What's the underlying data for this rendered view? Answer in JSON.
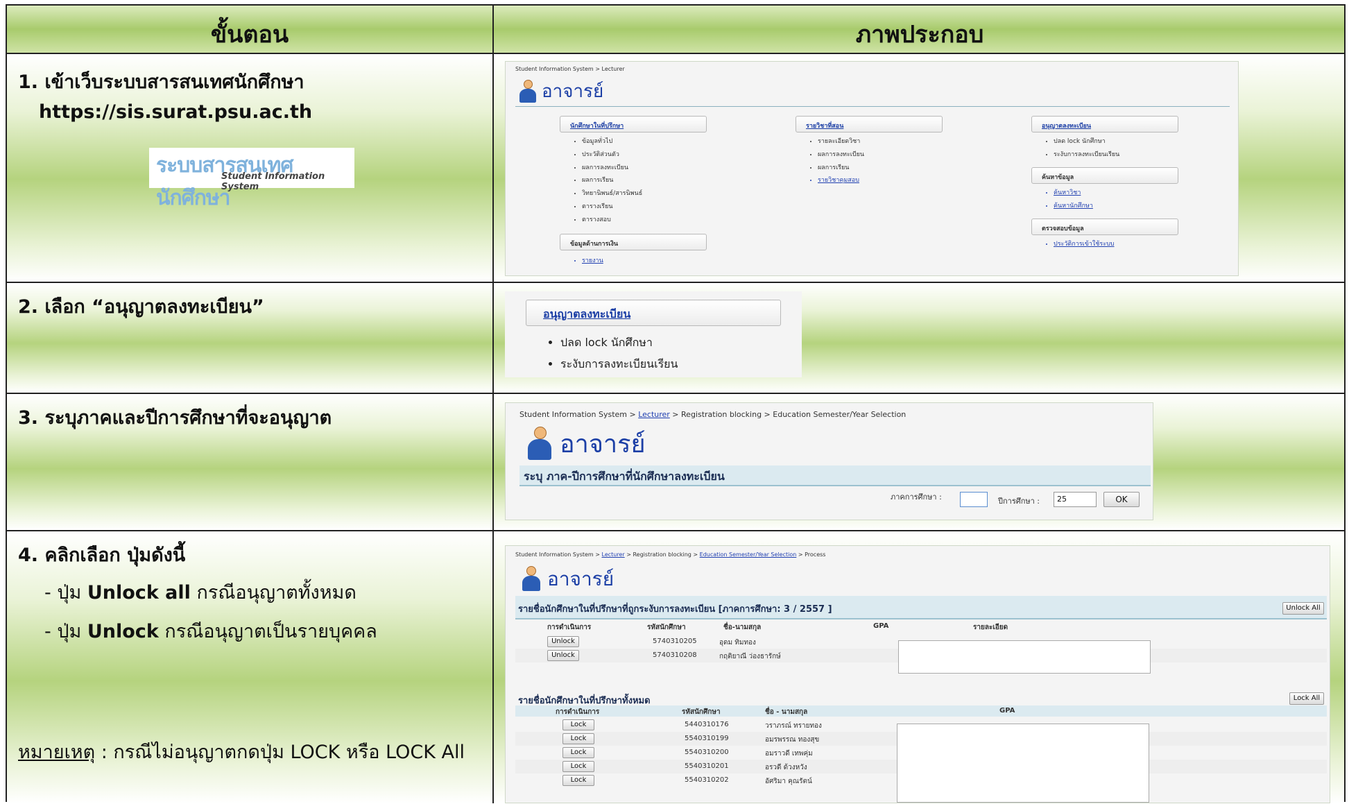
{
  "header": {
    "col1": "ขั้นตอน",
    "col2": "ภาพประกอบ"
  },
  "step1": {
    "title": "1. เข้าเว็บระบบสารสนเทศนักศึกษา",
    "url": "https://sis.surat.psu.ac.th",
    "logo_text": "ระบบสารสนเทศนักศึกษา",
    "logo_sub": "Student Information System",
    "shot": {
      "breadcrumb": "Student Information System > Lecturer",
      "title": "อาจารย์",
      "col1": {
        "header": "นักศึกษาในที่ปรึกษา",
        "items": [
          "ข้อมูลทั่วไป",
          "ประวัติส่วนตัว",
          "ผลการลงทะเบียน",
          "ผลการเรียน",
          "วิทยานิพนธ์/สารนิพนธ์",
          "ตารางเรียน",
          "ตารางสอบ"
        ],
        "header2": "ข้อมูลด้านการเงิน",
        "items2": [
          "รายงาน"
        ]
      },
      "col2": {
        "header": "รายวิชาที่สอน",
        "items": [
          "รายละเอียดวิชา",
          "ผลการลงทะเบียน",
          "ผลการเรียน",
          "รายวิชาคุมสอบ"
        ]
      },
      "col3": {
        "header": "อนุญาตลงทะเบียน",
        "items": [
          "ปลด lock นักศึกษา",
          "ระงับการลงทะเบียนเรียน"
        ],
        "header2": "ค้นหาข้อมูล",
        "items2": [
          "ค้นหาวิชา",
          "ค้นหานักศึกษา"
        ],
        "header3": "ตรวจสอบข้อมูล",
        "items3": [
          "ประวัติการเข้าใช้ระบบ"
        ]
      }
    }
  },
  "step2": {
    "title": "2. เลือก “อนุญาตลงทะเบียน”",
    "shot": {
      "header": "อนุญาตลงทะเบียน",
      "items": [
        "ปลด lock นักศึกษา",
        "ระงับการลงทะเบียนเรียน"
      ]
    }
  },
  "step3": {
    "title": "3. ระบุภาคและปีการศึกษาที่จะอนุญาต",
    "shot": {
      "crumb_start": "Student Information System > ",
      "crumb_link": "Lecturer",
      "crumb_end": " > Registration blocking > Education Semester/Year Selection",
      "title": "อาจารย์",
      "subtitle": "ระบุ ภาค-ปีการศึกษาที่นักศึกษาลงทะเบียน",
      "semester_label": "ภาคการศึกษา :",
      "semester_value": "",
      "year_label": "ปีการศึกษา :",
      "year_value": "25",
      "ok": "OK"
    }
  },
  "step4": {
    "title": "4. คลิกเลือก ปุ่มดังนี้",
    "line1_pre": "- ปุ่ม ",
    "line1_bold": "Unlock all",
    "line1_post": " กรณีอนุญาตทั้งหมด",
    "line2_pre": "- ปุ่ม ",
    "line2_bold": "Unlock",
    "line2_post": "  กรณีอนุญาตเป็นรายบุคคล",
    "note_label": "หมายเหตุ",
    "note_text": " : กรณีไม่อนุญาตกดปุ่ม LOCK หรือ LOCK All",
    "shot": {
      "crumb_start": "Student Information System > ",
      "crumb_link1": "Lecturer",
      "crumb_mid": " > Registration blocking > ",
      "crumb_link2": "Education Semester/Year Selection",
      "crumb_end": " > Process",
      "title": "อาจารย์",
      "section1": "รายชื่อนักศึกษาในที่ปรึกษาที่ถูกระงับการลงทะเบียน  [ภาคการศึกษา: 3 / 2557 ]",
      "unlock_all": "Unlock All",
      "cols1": [
        "การดำเนินการ",
        "รหัสนักศึกษา",
        "ชื่อ-นามสกุล",
        "GPA",
        "รายละเอียด"
      ],
      "rows1": [
        {
          "action": "Unlock",
          "id": "5740310205",
          "name": "อุดม ทิมทอง"
        },
        {
          "action": "Unlock",
          "id": "5740310208",
          "name": "กฤติยาณี ว่องธารักษ์"
        }
      ],
      "section2": "รายชื่อนักศึกษาในที่ปรึกษาทั้งหมด",
      "lock_all": "Lock All",
      "cols2": [
        "การดำเนินการ",
        "รหัสนักศึกษา",
        "ชื่อ - นามสกุล",
        "GPA"
      ],
      "rows2": [
        {
          "action": "Lock",
          "id": "5440310176",
          "name": "วราภรณ์ ทรายทอง"
        },
        {
          "action": "Lock",
          "id": "5540310199",
          "name": "อมรพรรณ ทองสุข"
        },
        {
          "action": "Lock",
          "id": "5540310200",
          "name": "อมราวดี เทพคุ่ม"
        },
        {
          "action": "Lock",
          "id": "5540310201",
          "name": "อรวดี ด้วงหวัง"
        },
        {
          "action": "Lock",
          "id": "5540310202",
          "name": "อัศริมา คุณรัตน์"
        }
      ]
    }
  }
}
